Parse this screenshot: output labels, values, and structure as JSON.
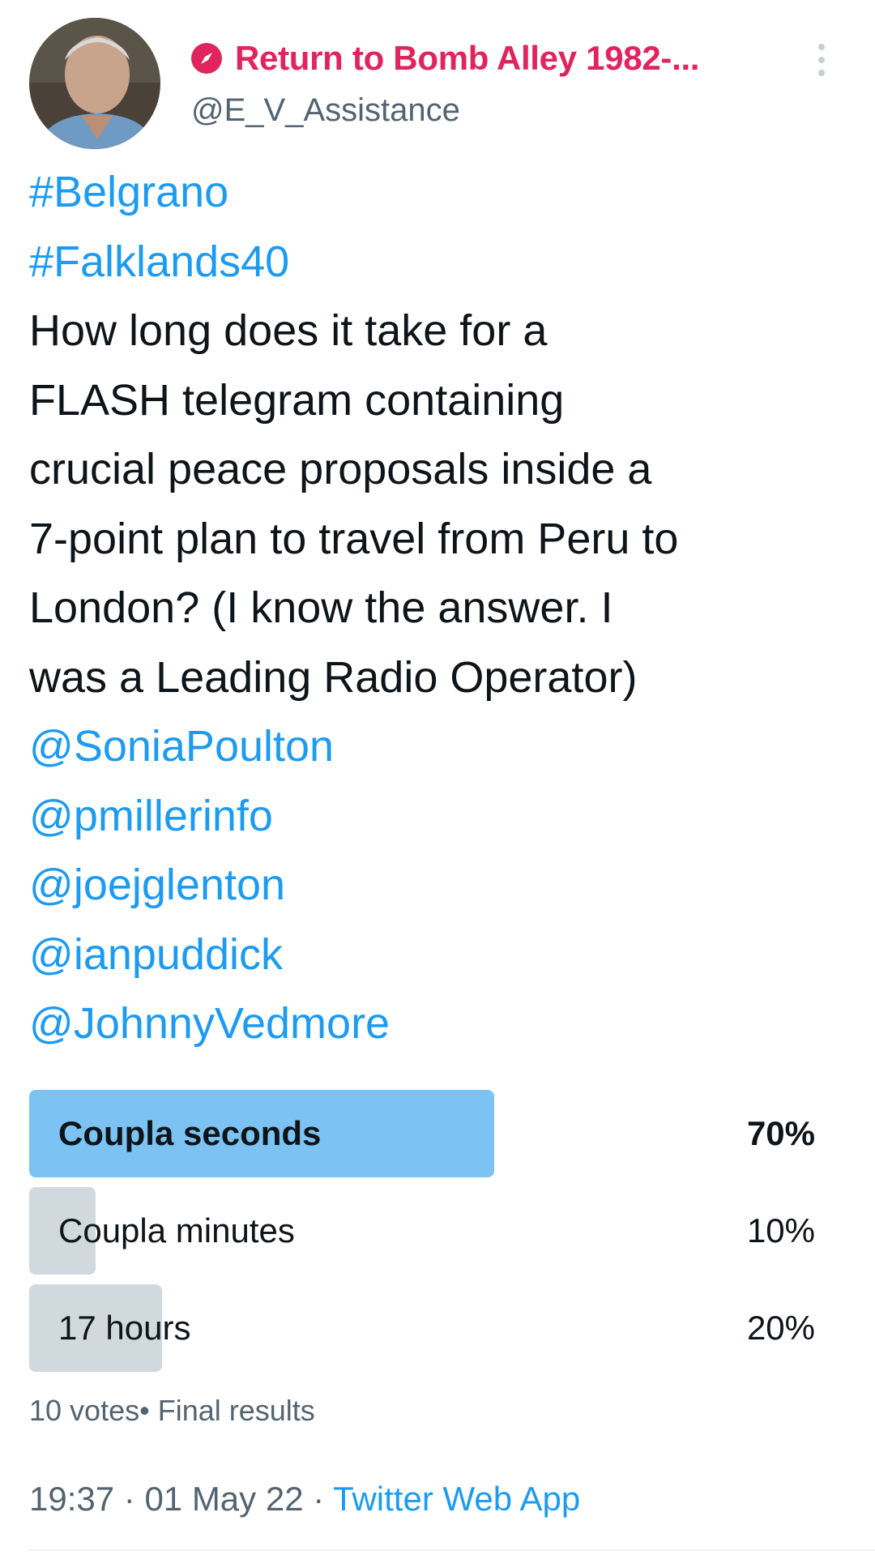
{
  "author": {
    "display_name": "Return to Bomb Alley 1982-...",
    "handle": "@E_V_Assistance",
    "name_color": "#e0245e"
  },
  "icons": {
    "name_badge": "compass-icon",
    "menu": "more-vertical-icon",
    "avatar": "profile-photo"
  },
  "tweet": {
    "hashtags": [
      "#Belgrano",
      "#Falklands40"
    ],
    "body_lines": [
      "How long does it take for a",
      "FLASH telegram containing",
      "crucial peace proposals inside a",
      "7-point plan to travel from Peru to",
      "London? (I know the answer. I",
      "was a Leading Radio Operator)"
    ],
    "mentions": [
      "@SoniaPoulton",
      "@pmillerinfo",
      "@joejglenton",
      "@ianpuddick",
      "@JohnnyVedmore"
    ]
  },
  "poll": {
    "options": [
      {
        "label": "Coupla seconds",
        "percent_text": "70%",
        "fill": 0.7,
        "winner": true
      },
      {
        "label": "Coupla minutes",
        "percent_text": "10%",
        "fill": 0.1,
        "winner": false
      },
      {
        "label": "17 hours",
        "percent_text": "20%",
        "fill": 0.2,
        "winner": false
      }
    ],
    "votes_text": "10 votes",
    "status_text": "Final results"
  },
  "meta": {
    "time": "19:37",
    "date": "01 May 22",
    "app": "Twitter Web App"
  },
  "colors": {
    "link": "#1d9bf0",
    "winner_bar": "#7cc3f3",
    "other_bar": "#cfd9de",
    "muted_text": "#536471"
  }
}
